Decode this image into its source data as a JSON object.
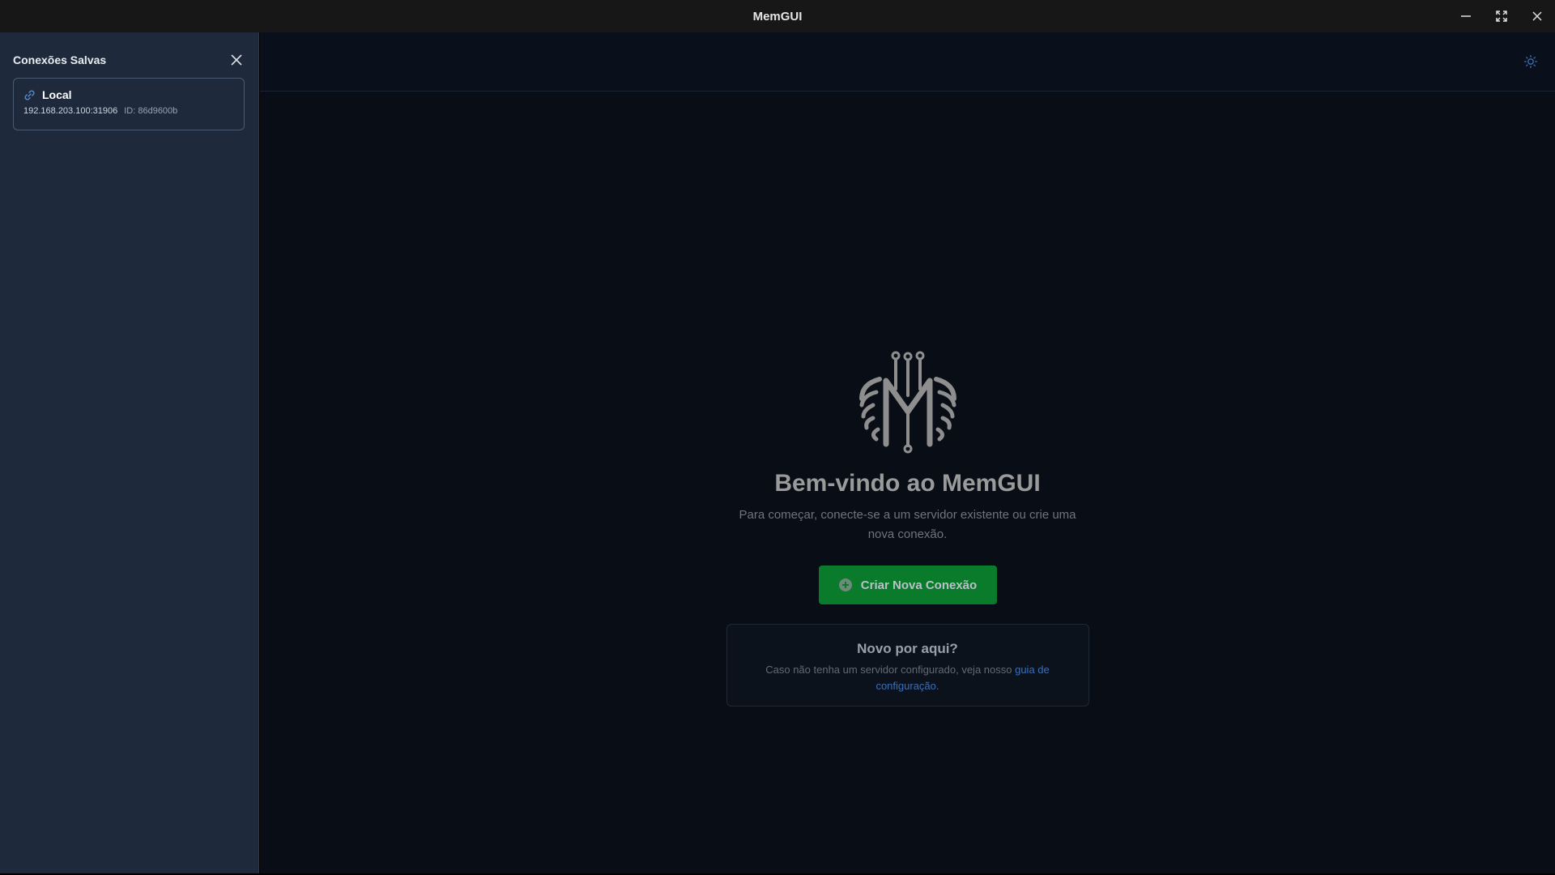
{
  "window": {
    "title": "MemGUI",
    "controls": [
      "minimize-icon",
      "maximize-icon",
      "close-icon"
    ]
  },
  "sidebar": {
    "title": "Conexões Salvas",
    "close_icon": "close-icon",
    "connections": [
      {
        "icon": "link-icon",
        "name": "Local",
        "address": "192.168.203.100:31906",
        "id_label": "ID: 86d9600b"
      }
    ]
  },
  "header": {
    "theme_icon": "sun-icon"
  },
  "welcome": {
    "logo": "memgui-logo",
    "title": "Bem-vindo ao MemGUI",
    "subtitle": "Para começar, conecte-se a um servidor existente ou crie uma nova conexão.",
    "create_button": "Criar Nova Conexão",
    "create_icon": "plus-circle-icon"
  },
  "help": {
    "title": "Novo por aqui?",
    "text": "Caso não tenha um servidor configurado, veja nosso ",
    "link": "guia de configuração",
    "after_link": "."
  },
  "colors": {
    "accent": "#0a7a2b",
    "link": "#3b6fb8",
    "sidebar_bg": "#1e2a3b",
    "main_bg": "#080d16"
  }
}
